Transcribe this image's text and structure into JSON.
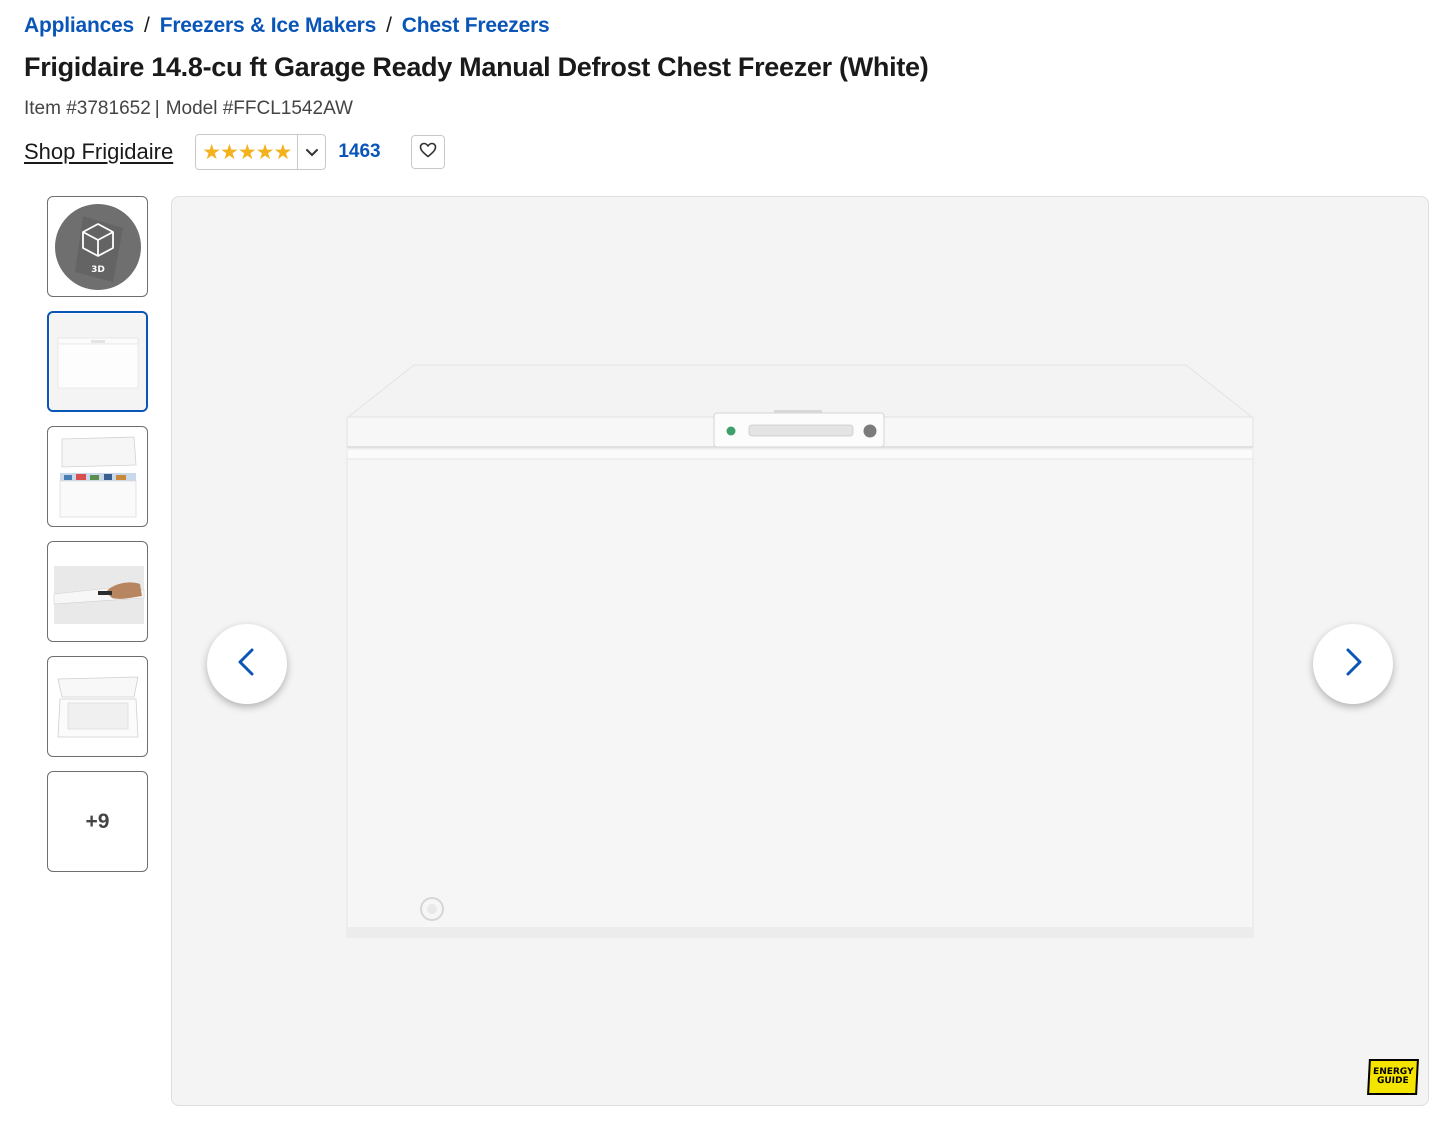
{
  "breadcrumb": {
    "items": [
      "Appliances",
      "Freezers & Ice Makers",
      "Chest Freezers"
    ],
    "separator": "/"
  },
  "product": {
    "title": "Frigidaire 14.8-cu ft Garage Ready Manual Defrost Chest Freezer (White)",
    "item_number": "Item #3781652",
    "model_number": "Model #FFCL1542AW",
    "pipe": "|",
    "shop_brand": "Shop Frigidaire"
  },
  "rating": {
    "stars": "★★★★★",
    "review_count": "1463",
    "star_color": "#f3b21b"
  },
  "icons": {
    "favorite": "heart-icon",
    "rating_toggle": "chevron-down-icon",
    "prev": "chevron-left-icon",
    "next": "chevron-right-icon",
    "three_d": "cube-3d-icon"
  },
  "thumbnails": {
    "three_d_label": "3D",
    "more_label": "+9"
  },
  "viewer": {
    "energy_badge_line1": "ENERGY",
    "energy_badge_line2": "GUIDE"
  },
  "colors": {
    "link": "#0a55b8",
    "active_border": "#0a55b8",
    "energy_yellow": "#f5e400"
  }
}
